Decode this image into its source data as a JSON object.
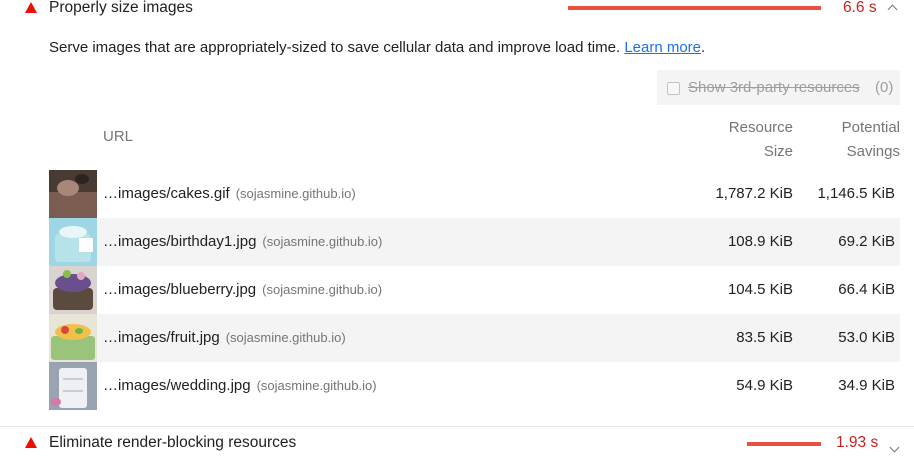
{
  "audits": [
    {
      "title": "Properly size images",
      "score": "6.6 s"
    },
    {
      "title": "Eliminate render-blocking resources",
      "score": "1.93 s"
    }
  ],
  "description": {
    "text": "Serve images that are appropriately-sized to save cellular data and improve load time.",
    "link": "Learn more",
    "end": "."
  },
  "third_party": {
    "label": "Show 3rd-party resources",
    "count": "(0)"
  },
  "table": {
    "headers": {
      "url": "URL",
      "resource_1": "Resource",
      "resource_2": "Size",
      "savings_1": "Potential",
      "savings_2": "Savings"
    },
    "rows": [
      {
        "url": "…images/cakes.gif",
        "host": "(sojasmine.github.io)",
        "size": "1,787.2 KiB",
        "savings": "1,146.5 KiB"
      },
      {
        "url": "…images/birthday1.jpg",
        "host": "(sojasmine.github.io)",
        "size": "108.9 KiB",
        "savings": "69.2 KiB"
      },
      {
        "url": "…images/blueberry.jpg",
        "host": "(sojasmine.github.io)",
        "size": "104.5 KiB",
        "savings": "66.4 KiB"
      },
      {
        "url": "…images/fruit.jpg",
        "host": "(sojasmine.github.io)",
        "size": "83.5 KiB",
        "savings": "53.0 KiB"
      },
      {
        "url": "…images/wedding.jpg",
        "host": "(sojasmine.github.io)",
        "size": "54.9 KiB",
        "savings": "34.9 KiB"
      }
    ]
  },
  "colors": {
    "fail": "#eb0f00",
    "bar": "#e8503f",
    "score": "#c7221f",
    "link": "#1a73e8"
  }
}
